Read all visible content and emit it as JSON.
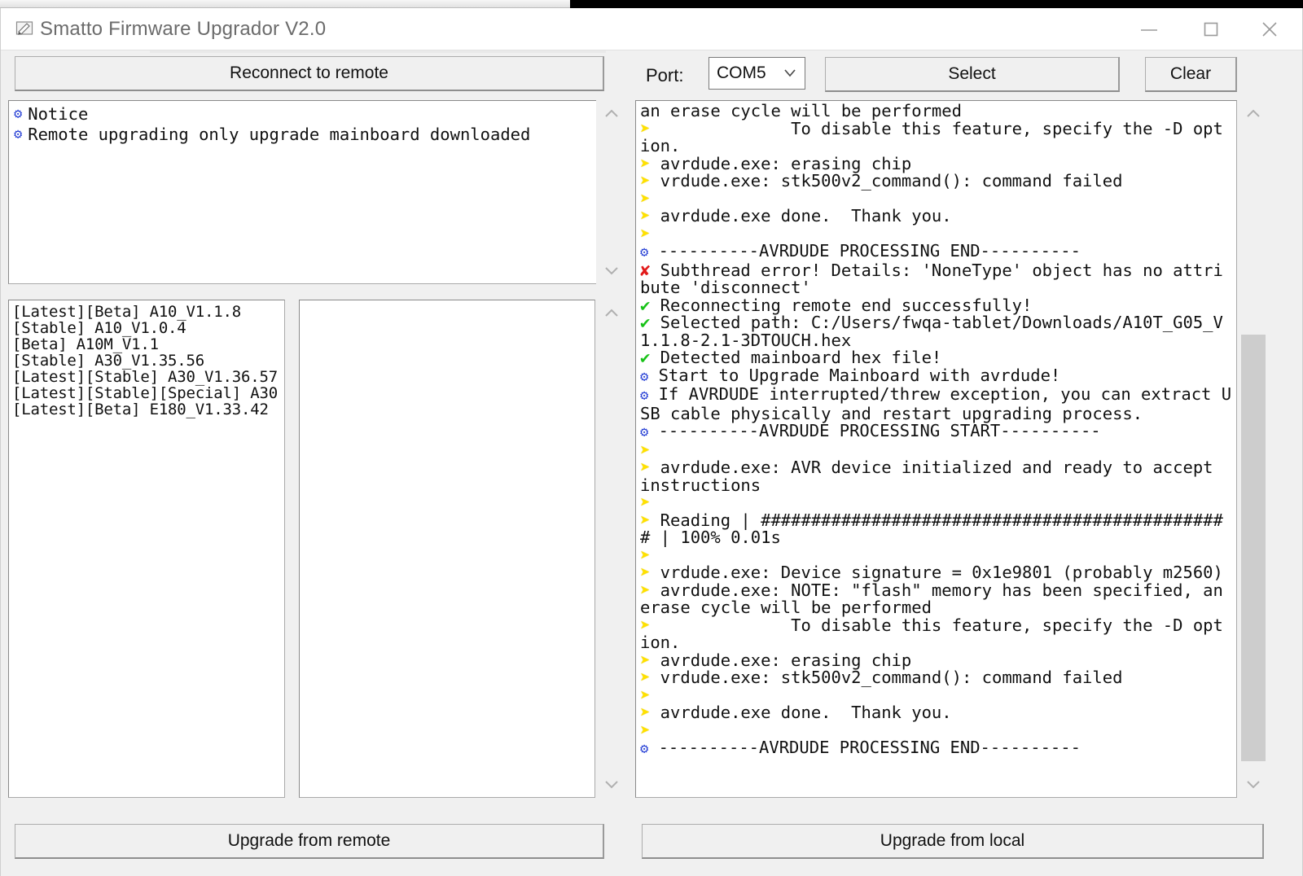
{
  "window": {
    "title": "Smatto Firmware Upgrador V2.0",
    "icon": "app-pencil-icon",
    "controls": {
      "minimize": "minimize",
      "maximize": "maximize",
      "close": "close"
    }
  },
  "toolbar": {
    "reconnect_label": "Reconnect to remote",
    "port_label": "Port:",
    "port_value": "COM5",
    "port_options": [
      "COM5"
    ],
    "select_label": "Select",
    "clear_label": "Clear"
  },
  "notice": {
    "lines": [
      {
        "marker": "gear",
        "text": "Notice"
      },
      {
        "marker": "gear",
        "text": "Remote upgrading only upgrade mainboard downloaded"
      }
    ]
  },
  "firmware_list": {
    "items": [
      "[Latest][Beta] A10_V1.1.8",
      "[Stable] A10_V1.0.4",
      "[Beta] A10M_V1.1",
      "[Stable] A30_V1.35.56",
      "[Latest][Stable] A30_V1.36.57",
      "[Latest][Stable][Special] A30",
      "[Latest][Beta] E180_V1.33.42"
    ]
  },
  "detail_list": {
    "items": []
  },
  "log": {
    "lines": [
      {
        "marker": "none",
        "text": "an erase cycle will be performed"
      },
      {
        "marker": "arrow",
        "text": "              To disable this feature, specify the -D option."
      },
      {
        "marker": "arrow",
        "text": " avrdude.exe: erasing chip"
      },
      {
        "marker": "arrow",
        "text": " vrdude.exe: stk500v2_command(): command failed"
      },
      {
        "marker": "arrow",
        "text": ""
      },
      {
        "marker": "arrow",
        "text": " avrdude.exe done.  Thank you."
      },
      {
        "marker": "arrow",
        "text": ""
      },
      {
        "marker": "gear",
        "text": " ----------AVRDUDE PROCESSING END----------"
      },
      {
        "marker": "err",
        "text": " Subthread error! Details: 'NoneType' object has no attribute 'disconnect'"
      },
      {
        "marker": "ok",
        "text": " Reconnecting remote end successfully!"
      },
      {
        "marker": "ok",
        "text": " Selected path: C:/Users/fwqa-tablet/Downloads/A10T_G05_V1.1.8-2.1-3DTOUCH.hex"
      },
      {
        "marker": "ok",
        "text": " Detected mainboard hex file!"
      },
      {
        "marker": "gear",
        "text": " Start to Upgrade Mainboard with avrdude!"
      },
      {
        "marker": "gear",
        "text": " If AVRDUDE interrupted/threw exception, you can extract USB cable physically and restart upgrading process."
      },
      {
        "marker": "gear",
        "text": " ----------AVRDUDE PROCESSING START----------"
      },
      {
        "marker": "arrow",
        "text": ""
      },
      {
        "marker": "arrow",
        "text": " avrdude.exe: AVR device initialized and ready to accept instructions"
      },
      {
        "marker": "arrow",
        "text": ""
      },
      {
        "marker": "arrow",
        "text": " Reading | ############################################### | 100% 0.01s"
      },
      {
        "marker": "arrow",
        "text": ""
      },
      {
        "marker": "arrow",
        "text": " vrdude.exe: Device signature = 0x1e9801 (probably m2560)"
      },
      {
        "marker": "arrow",
        "text": " avrdude.exe: NOTE: \"flash\" memory has been specified, an erase cycle will be performed"
      },
      {
        "marker": "arrow",
        "text": "              To disable this feature, specify the -D option."
      },
      {
        "marker": "arrow",
        "text": " avrdude.exe: erasing chip"
      },
      {
        "marker": "arrow",
        "text": " vrdude.exe: stk500v2_command(): command failed"
      },
      {
        "marker": "arrow",
        "text": ""
      },
      {
        "marker": "arrow",
        "text": " avrdude.exe done.  Thank you."
      },
      {
        "marker": "arrow",
        "text": ""
      },
      {
        "marker": "gear",
        "text": " ----------AVRDUDE PROCESSING END----------"
      }
    ]
  },
  "footer": {
    "upgrade_remote_label": "Upgrade from remote",
    "upgrade_local_label": "Upgrade from local"
  },
  "colors": {
    "arrow_marker": "#ffe100",
    "gear_marker": "#2a43d6",
    "ok_marker": "#18c218",
    "error_marker": "#e21b1b",
    "window_bg": "#f0f0f0"
  }
}
